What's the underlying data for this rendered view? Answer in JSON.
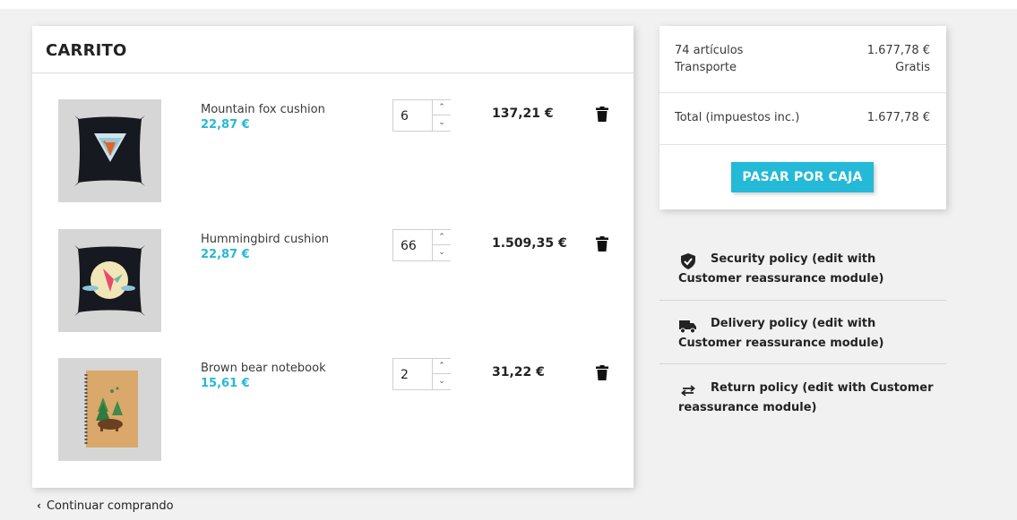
{
  "cart": {
    "title": "CARRITO",
    "items": [
      {
        "name": "Mountain fox cushion",
        "price": "22,87 €",
        "qty": "6",
        "total": "137,21 €",
        "image_icon": "fox-cushion-image"
      },
      {
        "name": "Hummingbird cushion",
        "price": "22,87 €",
        "qty": "66",
        "total": "1.509,35 €",
        "image_icon": "hummingbird-cushion-image"
      },
      {
        "name": "Brown bear notebook",
        "price": "15,61 €",
        "qty": "2",
        "total": "31,22 €",
        "image_icon": "bear-notebook-image"
      }
    ],
    "continue_label": "Continuar comprando",
    "qty_up_icon": "chevron-up-icon",
    "qty_down_icon": "chevron-down-icon",
    "delete_icon": "trash-icon"
  },
  "summary": {
    "items_label": "74 artículos",
    "items_value": "1.677,78 €",
    "shipping_label": "Transporte",
    "shipping_value": "Gratis",
    "total_label": "Total (impuestos inc.)",
    "total_value": "1.677,78 €",
    "checkout_label": "PASAR POR CAJA"
  },
  "reassurance": [
    {
      "icon": "shield-check-icon",
      "text": "Security policy (edit with Customer reassurance module)"
    },
    {
      "icon": "truck-icon",
      "text": "Delivery policy (edit with Customer reassurance module)"
    },
    {
      "icon": "exchange-arrows-icon",
      "text": "Return policy (edit with Customer reassurance module)"
    }
  ],
  "colors": {
    "accent": "#24b9d7",
    "page_background": "#f1f1f1",
    "card_background": "#ffffff",
    "text": "#232323"
  }
}
